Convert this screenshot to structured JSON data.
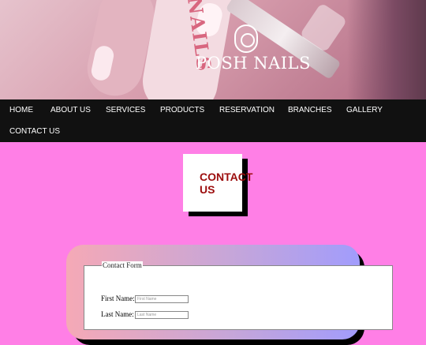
{
  "hero": {
    "brand": "POSH NAILS",
    "bottle_text": "H NAILS"
  },
  "nav": {
    "items": [
      "HOME",
      "ABOUT US",
      "SERVICES",
      "PRODUCTS",
      "RESERVATION",
      "BRANCHES",
      "GALLERY",
      "CONTACT US"
    ]
  },
  "page": {
    "title": "CONTACT US"
  },
  "form": {
    "legend": "Contact Form",
    "first_name_label": "First Name:",
    "first_name_placeholder": "First Name",
    "last_name_label": "Last Name:",
    "last_name_placeholder": "Last Name"
  },
  "colors": {
    "background": "#ff7fe6",
    "nav": "#111111",
    "title_text": "#9c0d0d"
  }
}
